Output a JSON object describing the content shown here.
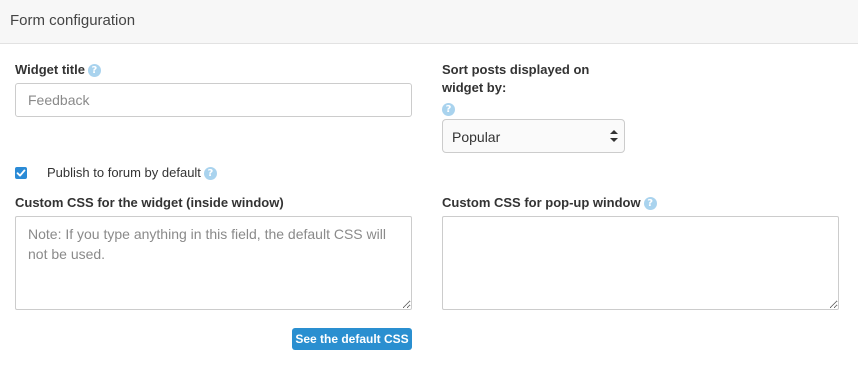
{
  "panel": {
    "title": "Form configuration"
  },
  "widget_title": {
    "label": "Widget title",
    "placeholder": "Feedback"
  },
  "sort_posts": {
    "label_line1": "Sort posts displayed on",
    "label_line2": "widget by:",
    "selected": "Popular"
  },
  "publish": {
    "label": "Publish to forum by default",
    "checked": true
  },
  "custom_css_widget": {
    "label": "Custom CSS for the widget (inside window)",
    "placeholder": "Note: If you type anything in this field, the default CSS will not be used."
  },
  "custom_css_popup": {
    "label": "Custom CSS for pop-up window",
    "placeholder": ""
  },
  "default_css_button": {
    "label": "See the default CSS"
  },
  "help_glyph": "?",
  "colors": {
    "accent": "#2a8fd0",
    "help_icon": "#a9d3ee",
    "header_bg": "#f7f7f7"
  }
}
